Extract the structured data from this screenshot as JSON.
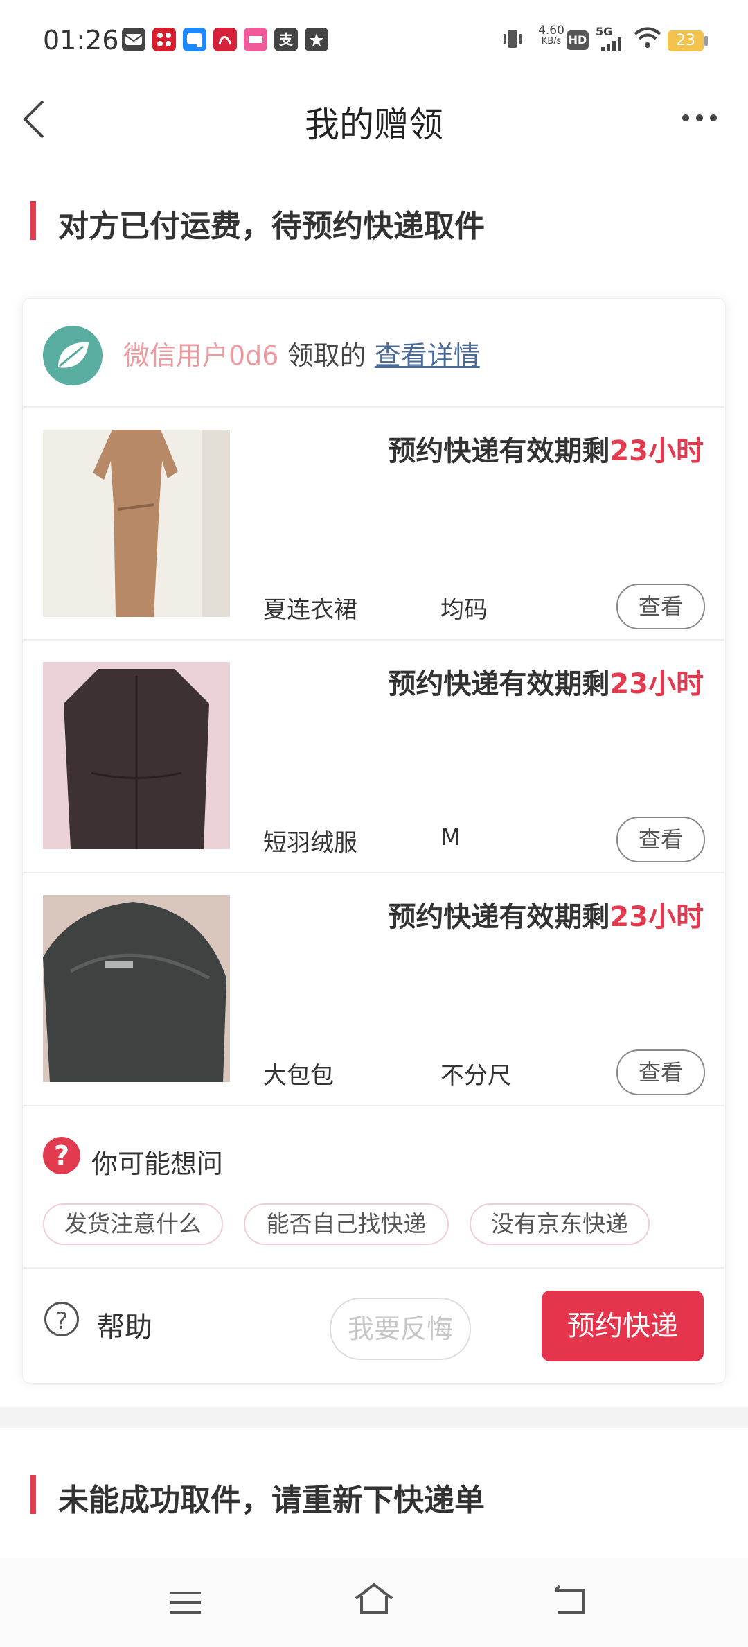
{
  "status_bar": {
    "time": "01:26",
    "net_speed_value": "4.60",
    "net_speed_unit": "KB/s",
    "hd": "HD",
    "network": "5G",
    "battery": "23",
    "notification_icons": [
      {
        "name": "message-app-icon",
        "color": "#444444"
      },
      {
        "name": "pinduoduo-app-icon",
        "color": "#d81e2d"
      },
      {
        "name": "chat-app-icon",
        "color": "#1e88ff"
      },
      {
        "name": "red-app-icon",
        "color": "#d6213a"
      },
      {
        "name": "pink-app-icon",
        "color": "#ee5a9a"
      },
      {
        "name": "alipay-icon",
        "color": "#444444",
        "glyph": "支"
      },
      {
        "name": "star-message-icon",
        "color": "#444444"
      }
    ]
  },
  "nav": {
    "title": "我的赠领"
  },
  "section1": {
    "title": "对方已付运费，待预约快递取件"
  },
  "claimer": {
    "name": "微信用户0d6",
    "suffix": "领取的",
    "link": "查看详情"
  },
  "products": [
    {
      "validity_prefix": "预约快递有效期剩",
      "validity_hours": "23小时",
      "name": "夏连衣裙",
      "size": "均码",
      "view_label": "查看"
    },
    {
      "validity_prefix": "预约快递有效期剩",
      "validity_hours": "23小时",
      "name": "短羽绒服",
      "size": "M",
      "view_label": "查看"
    },
    {
      "validity_prefix": "预约快递有效期剩",
      "validity_hours": "23小时",
      "name": "大包包",
      "size": "不分尺",
      "view_label": "查看"
    }
  ],
  "faq": {
    "title": "你可能想问",
    "chips": [
      "发货注意什么",
      "能否自己找快递",
      "没有京东快递"
    ]
  },
  "actions": {
    "help": "帮助",
    "regret": "我要反悔",
    "book": "预约快递"
  },
  "section2": {
    "title": "未能成功取件，请重新下快递单"
  },
  "colors": {
    "accent": "#e23a4f",
    "link": "#4a6a9a",
    "claimer_name": "#e99ba0"
  }
}
